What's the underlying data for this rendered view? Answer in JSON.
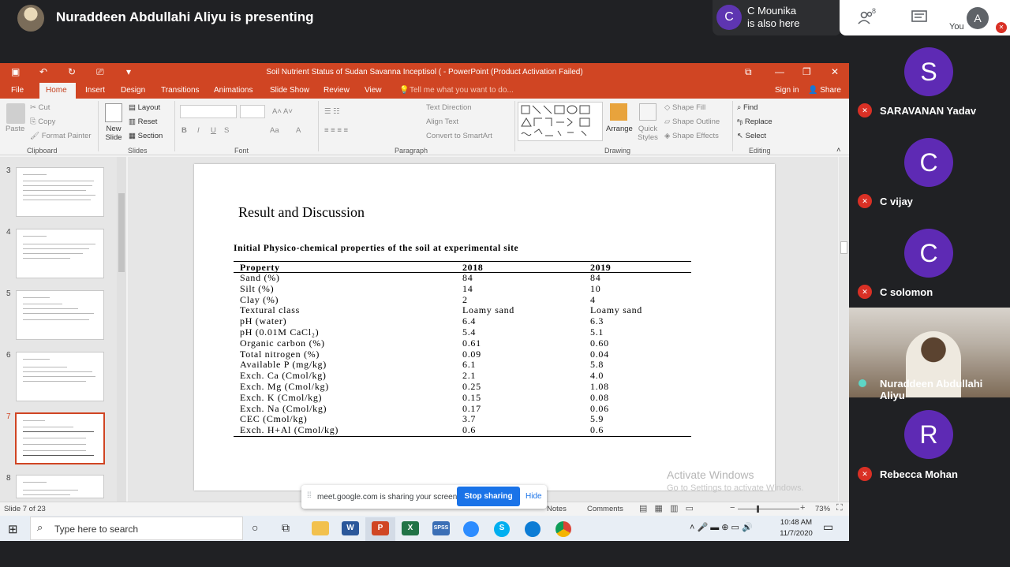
{
  "meet": {
    "presenting_text": "Nuraddeen Abdullahi Aliyu is presenting",
    "also_here": {
      "initial": "C",
      "name": "C Mounika",
      "status": "is also here"
    },
    "people_count": "8",
    "you_label": "You",
    "you_initial": "A",
    "participants": [
      {
        "initial": "S",
        "name": "SARAVANAN Yadav"
      },
      {
        "initial": "C",
        "name": "C vijay"
      },
      {
        "initial": "C",
        "name": "C solomon"
      },
      {
        "initial": "",
        "name": "Nuraddeen Abdullahi Aliyu"
      },
      {
        "initial": "R",
        "name": "Rebecca Mohan"
      }
    ],
    "sharing": {
      "text": "meet.google.com is sharing your screen.",
      "stop": "Stop sharing",
      "hide": "Hide"
    }
  },
  "ppt": {
    "title": "Soil Nutrient Status of Sudan Savanna Inceptisol ( - PowerPoint (Product Activation Failed)",
    "tabs": [
      "File",
      "Home",
      "Insert",
      "Design",
      "Transitions",
      "Animations",
      "Slide Show",
      "Review",
      "View"
    ],
    "tell_me": "Tell me what you want to do...",
    "sign_in": "Sign in",
    "share": "Share",
    "ribbon": {
      "clipboard": {
        "label": "Clipboard",
        "paste": "Paste",
        "cut": "Cut",
        "copy": "Copy",
        "format_painter": "Format Painter"
      },
      "slides": {
        "label": "Slides",
        "new_slide": "New Slide",
        "layout": "Layout",
        "reset": "Reset",
        "section": "Section"
      },
      "font": {
        "label": "Font"
      },
      "paragraph": {
        "label": "Paragraph",
        "text_direction": "Text Direction",
        "align_text": "Align Text",
        "convert_smartart": "Convert to SmartArt"
      },
      "drawing": {
        "label": "Drawing",
        "arrange": "Arrange",
        "quick_styles": "Quick Styles",
        "shape_fill": "Shape Fill",
        "shape_outline": "Shape Outline",
        "shape_effects": "Shape Effects"
      },
      "editing": {
        "label": "Editing",
        "find": "Find",
        "replace": "Replace",
        "select": "Select"
      }
    },
    "thumbnails": [
      "3",
      "4",
      "5",
      "6",
      "7",
      "8"
    ],
    "selected_slide": "7",
    "slide": {
      "title": "Result and Discussion",
      "caption": "Initial Physico-chemical properties of the soil at experimental site",
      "headers": [
        "Property",
        "2018",
        "2019"
      ],
      "rows": [
        [
          "Sand (%)",
          "84",
          "84"
        ],
        [
          "Silt (%)",
          "14",
          "10"
        ],
        [
          "Clay (%)",
          "2",
          "4"
        ],
        [
          "Textural class",
          "Loamy sand",
          "Loamy sand"
        ],
        [
          "pH (water)",
          "6.4",
          "6.3"
        ],
        [
          "pH (0.01M CaCl₂)",
          "5.4",
          "5.1"
        ],
        [
          "Organic carbon (%)",
          "0.61",
          "0.60"
        ],
        [
          "Total nitrogen (%)",
          "0.09",
          "0.04"
        ],
        [
          "Available P (mg/kg)",
          "6.1",
          "5.8"
        ],
        [
          "Exch. Ca (Cmol/kg)",
          "2.1",
          "4.0"
        ],
        [
          "Exch. Mg (Cmol/kg)",
          "0.25",
          "1.08"
        ],
        [
          "Exch. K (Cmol/kg)",
          "0.15",
          "0.08"
        ],
        [
          "Exch. Na (Cmol/kg)",
          "0.17",
          "0.06"
        ],
        [
          "CEC (Cmol/kg)",
          "3.7",
          "5.9"
        ],
        [
          "Exch. H+Al (Cmol/kg)",
          "0.6",
          "0.6"
        ]
      ]
    },
    "watermark": {
      "line1": "Activate Windows",
      "line2": "Go to Settings to activate Windows."
    },
    "status": {
      "slide_of": "Slide 7 of 23",
      "notes": "Notes",
      "comments": "Comments",
      "zoom": "73%"
    }
  },
  "taskbar": {
    "search_placeholder": "Type here to search",
    "time": "10:48 AM",
    "date": "11/7/2020"
  },
  "colors": {
    "ppt_accent": "#d04523",
    "meet_bg": "#202124",
    "avatar_purple": "#5e2ab4",
    "mute_red": "#d93025",
    "stop_blue": "#1a73e8"
  }
}
